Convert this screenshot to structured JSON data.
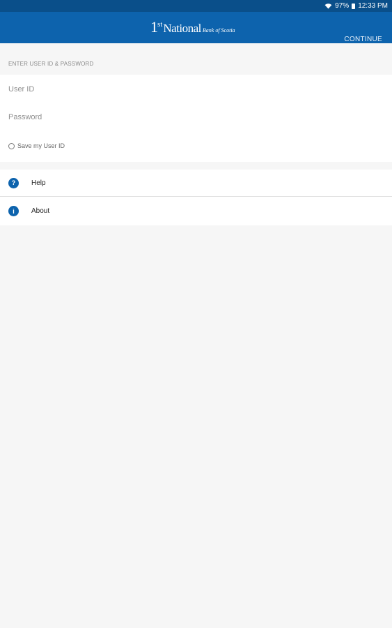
{
  "status_bar": {
    "battery": "97%",
    "time": "12:33 PM",
    "icons": [
      "wifi-icon",
      "battery-icon"
    ]
  },
  "app_bar": {
    "logo": {
      "numeral": "1",
      "superscript": "st",
      "name": "National",
      "tagline": "Bank of Scotia"
    },
    "continue_label": "CONTINUE"
  },
  "login": {
    "section_label": "ENTER USER ID & PASSWORD",
    "user_id": {
      "placeholder": "User ID",
      "value": ""
    },
    "password": {
      "placeholder": "Password",
      "value": ""
    },
    "save_user_id": {
      "label": "Save my User ID",
      "checked": false
    }
  },
  "menu": {
    "items": [
      {
        "label": "Help",
        "icon": "help-icon",
        "glyph": "?"
      },
      {
        "label": "About",
        "icon": "info-icon",
        "glyph": "i"
      }
    ]
  },
  "colors": {
    "status_bar": "#0a4f8a",
    "app_bar": "#0d63ad",
    "background": "#f6f6f6",
    "card": "#ffffff",
    "icon": "#0d63ad"
  }
}
